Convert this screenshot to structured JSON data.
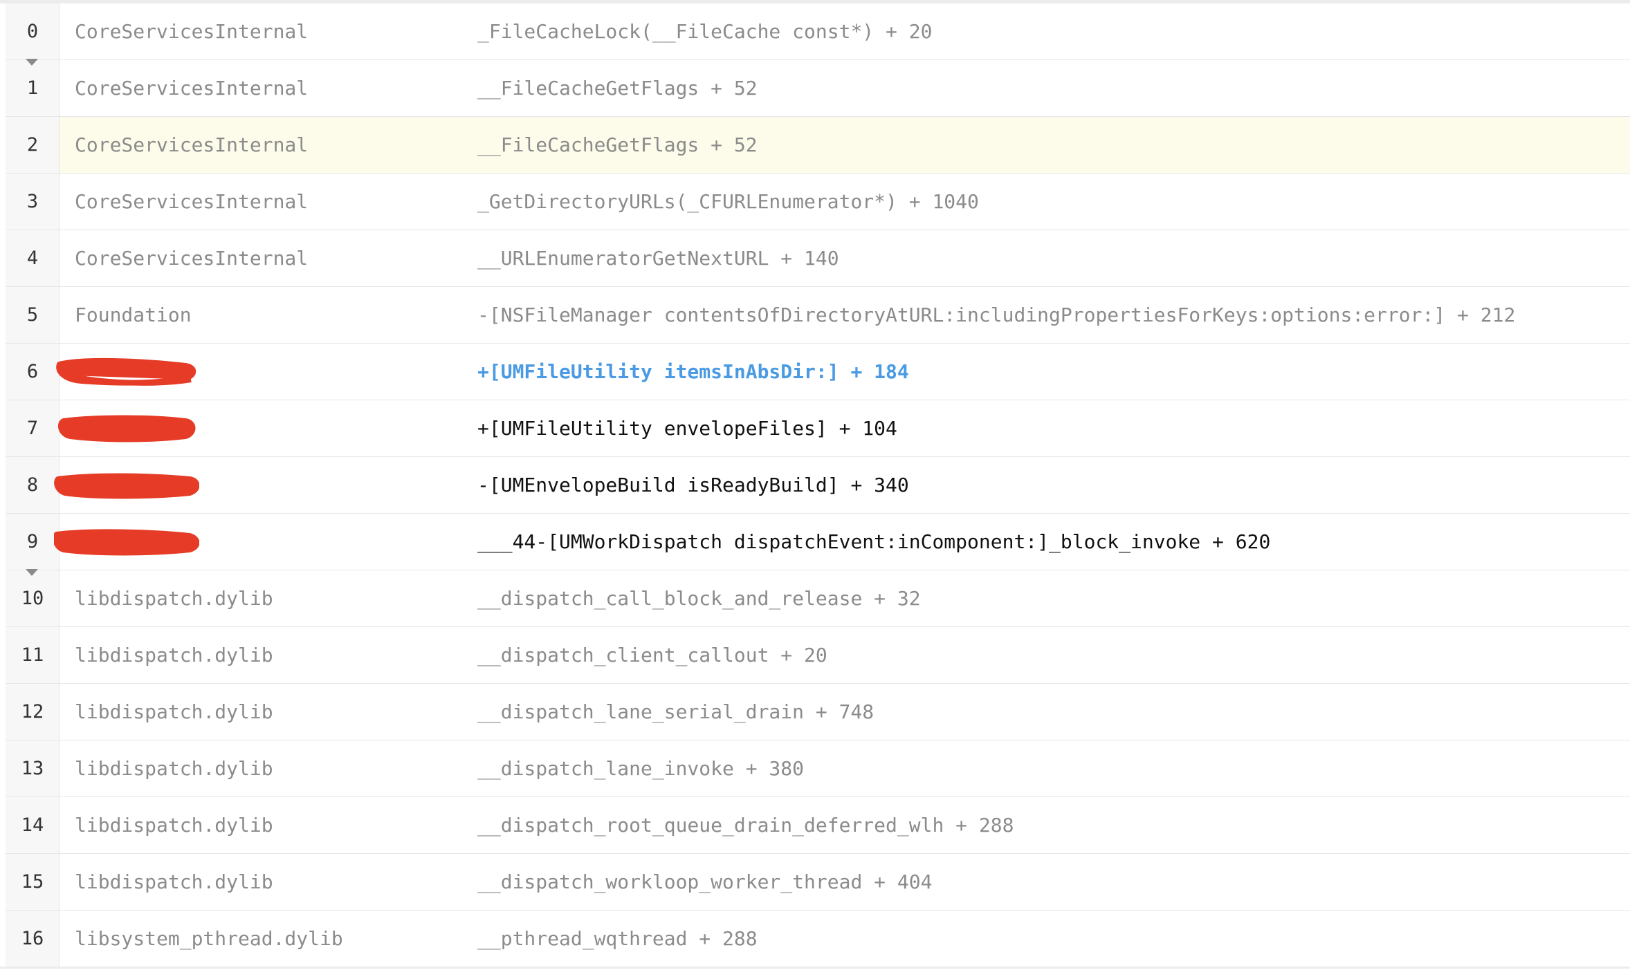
{
  "stack_trace": {
    "frames": [
      {
        "index": "0",
        "module": "CoreServicesInternal",
        "symbol": "_FileCacheLock(__FileCache const*) + 20",
        "state": "system",
        "collapse_toggle": true
      },
      {
        "index": "1",
        "module": "CoreServicesInternal",
        "symbol": "__FileCacheGetFlags + 52",
        "state": "system"
      },
      {
        "index": "2",
        "module": "CoreServicesInternal",
        "symbol": "__FileCacheGetFlags + 52",
        "state": "highlighted"
      },
      {
        "index": "3",
        "module": "CoreServicesInternal",
        "symbol": "_GetDirectoryURLs(_CFURLEnumerator*) + 1040",
        "state": "system"
      },
      {
        "index": "4",
        "module": "CoreServicesInternal",
        "symbol": "__URLEnumeratorGetNextURL + 140",
        "state": "system"
      },
      {
        "index": "5",
        "module": "Foundation",
        "symbol": "-[NSFileManager contentsOfDirectoryAtURL:includingPropertiesForKeys:options:error:] + 212",
        "state": "system"
      },
      {
        "index": "6",
        "module": "",
        "symbol": "+[UMFileUtility itemsInAbsDir:] + 184",
        "state": "selected",
        "redacted": true
      },
      {
        "index": "7",
        "module": "",
        "symbol": "+[UMFileUtility envelopeFiles] + 104",
        "state": "app",
        "redacted": true
      },
      {
        "index": "8",
        "module": "",
        "symbol": "-[UMEnvelopeBuild isReadyBuild] + 340",
        "state": "app",
        "redacted": true
      },
      {
        "index": "9",
        "module": "",
        "symbol": "___44-[UMWorkDispatch dispatchEvent:inComponent:]_block_invoke + 620",
        "state": "app",
        "redacted": true,
        "collapse_toggle": true
      },
      {
        "index": "10",
        "module": "libdispatch.dylib",
        "symbol": "__dispatch_call_block_and_release + 32",
        "state": "system"
      },
      {
        "index": "11",
        "module": "libdispatch.dylib",
        "symbol": "__dispatch_client_callout + 20",
        "state": "system"
      },
      {
        "index": "12",
        "module": "libdispatch.dylib",
        "symbol": "__dispatch_lane_serial_drain + 748",
        "state": "system"
      },
      {
        "index": "13",
        "module": "libdispatch.dylib",
        "symbol": "__dispatch_lane_invoke + 380",
        "state": "system"
      },
      {
        "index": "14",
        "module": "libdispatch.dylib",
        "symbol": "__dispatch_root_queue_drain_deferred_wlh + 288",
        "state": "system"
      },
      {
        "index": "15",
        "module": "libdispatch.dylib",
        "symbol": "__dispatch_workloop_worker_thread + 404",
        "state": "system"
      },
      {
        "index": "16",
        "module": "libsystem_pthread.dylib",
        "symbol": "__pthread_wqthread + 288",
        "state": "system"
      }
    ]
  },
  "colors": {
    "system_text": "#8b8b8b",
    "app_text": "#111111",
    "selected_text": "#4a9be3",
    "highlight_row": "#fdfbe9",
    "redaction_mark": "#e63b26"
  }
}
